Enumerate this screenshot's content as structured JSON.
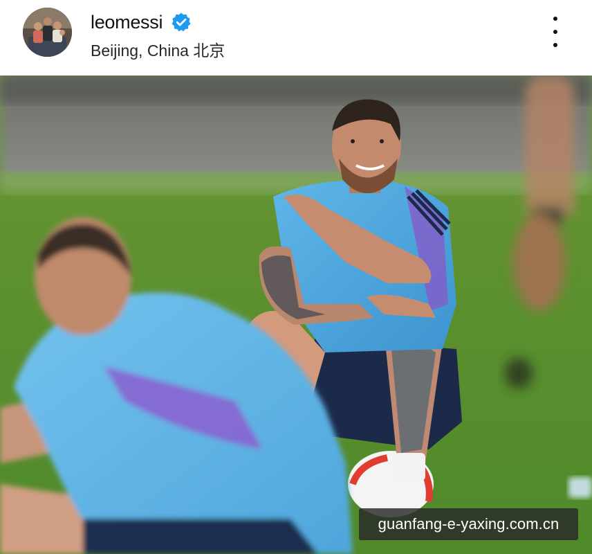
{
  "post_header": {
    "username": "leomessi",
    "location": "Beijing, China 北京",
    "verified": true,
    "menu_icon": "more-vertical-icon"
  },
  "photo": {
    "watermark_text": "guanfang-e-yaxing.com.cn"
  },
  "colors": {
    "verified_blue": "#1D9BF0",
    "text": "#111111",
    "watermark_bg": "#2a2a2a"
  }
}
